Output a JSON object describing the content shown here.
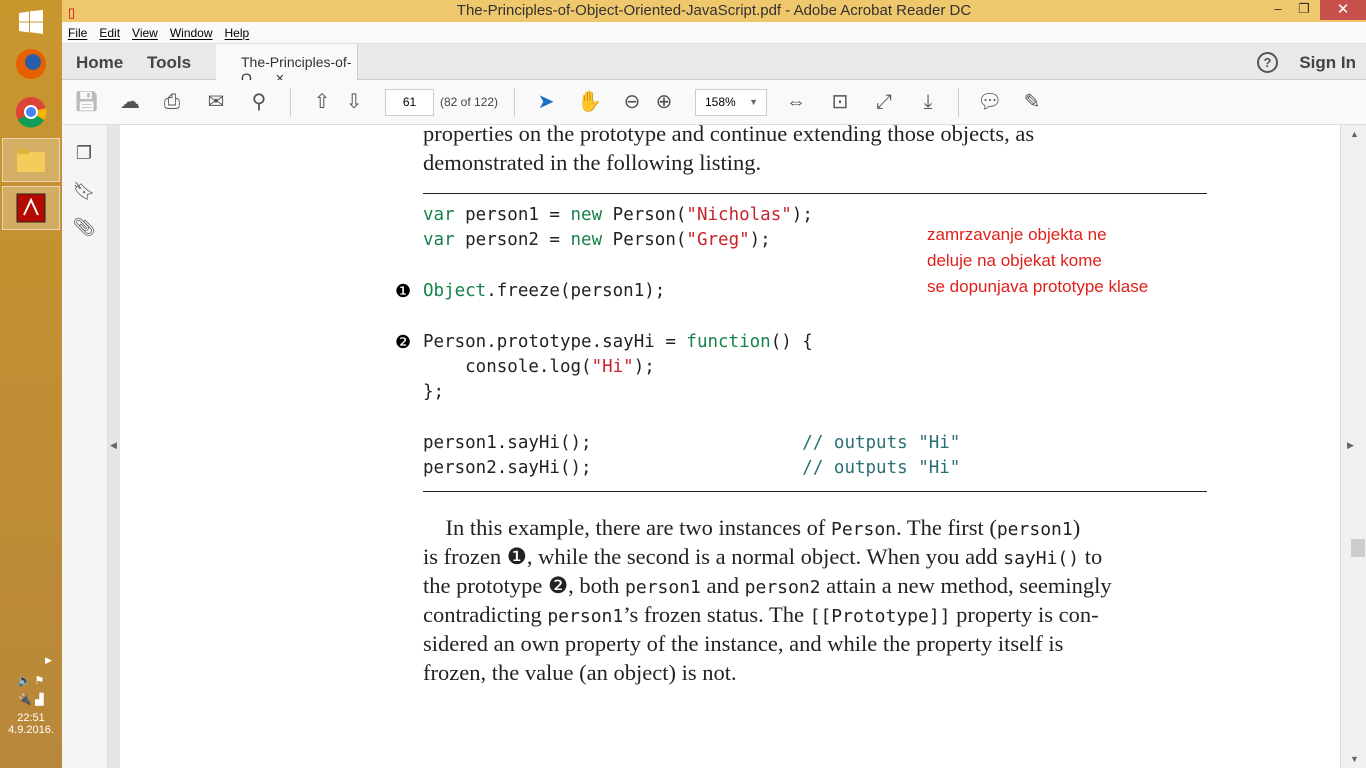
{
  "window": {
    "title": "The-Principles-of-Object-Oriented-JavaScript.pdf - Adobe Acrobat Reader DC",
    "minimize": "‒",
    "restore": "❐",
    "close": "✕"
  },
  "menu": [
    "File",
    "Edit",
    "View",
    "Window",
    "Help"
  ],
  "tabs": {
    "home": "Home",
    "tools": "Tools",
    "document": "The-Principles-of-O...",
    "close": "×",
    "help": "?",
    "sign_in": "Sign In"
  },
  "toolbar": {
    "page_number": "61",
    "page_count": "(82 of 122)",
    "zoom": "158%"
  },
  "tray": {
    "time": "22:51",
    "date": "4.9.2016."
  },
  "page": {
    "intro": [
      "properties on the prototype and continue extending those objects, as",
      "demonstrated in the following listing."
    ],
    "code": [
      [
        {
          "t": "var",
          "c": "kw"
        },
        {
          "t": " person1 = "
        },
        {
          "t": "new",
          "c": "kw"
        },
        {
          "t": " Person("
        },
        {
          "t": "\"Nicholas\"",
          "c": "str"
        },
        {
          "t": ");"
        }
      ],
      [
        {
          "t": "var",
          "c": "kw"
        },
        {
          "t": " person2 = "
        },
        {
          "t": "new",
          "c": "kw"
        },
        {
          "t": " Person("
        },
        {
          "t": "\"Greg\"",
          "c": "str"
        },
        {
          "t": ");"
        }
      ],
      [],
      [
        {
          "t": "Object",
          "c": "kw"
        },
        {
          "t": ".freeze(person1);"
        }
      ],
      [],
      [
        {
          "t": "Person.prototype.sayHi = "
        },
        {
          "t": "function",
          "c": "kw"
        },
        {
          "t": "() {"
        }
      ],
      [
        {
          "t": "    console.log("
        },
        {
          "t": "\"Hi\"",
          "c": "str"
        },
        {
          "t": ");"
        }
      ],
      [
        {
          "t": "};"
        }
      ],
      [],
      [
        {
          "t": "person1.sayHi();                    "
        },
        {
          "t": "// outputs \"Hi\"",
          "c": "cm"
        }
      ],
      [
        {
          "t": "person2.sayHi();                    "
        },
        {
          "t": "// outputs \"Hi\"",
          "c": "cm"
        }
      ]
    ],
    "markers": [
      "❶",
      "❷"
    ],
    "note": [
      "zamrzavanje objekta ne",
      "deluje na objekat kome",
      "se dopunjava prototype klase"
    ],
    "paragraph": [
      [
        {
          "t": "    In this example, there are two instances of "
        },
        {
          "t": "Person",
          "m": 1
        },
        {
          "t": ". The first ("
        },
        {
          "t": "person1",
          "m": 1
        },
        {
          "t": ")"
        }
      ],
      [
        {
          "t": "is frozen ❶, while the second is a normal object. When you add "
        },
        {
          "t": "sayHi()",
          "m": 1
        },
        {
          "t": " to"
        }
      ],
      [
        {
          "t": "the prototype ❷, both "
        },
        {
          "t": "person1",
          "m": 1
        },
        {
          "t": " and "
        },
        {
          "t": "person2",
          "m": 1
        },
        {
          "t": " attain a new method, seemingly"
        }
      ],
      [
        {
          "t": "contradicting "
        },
        {
          "t": "person1",
          "m": 1
        },
        {
          "t": "’s frozen status. The "
        },
        {
          "t": "[[Prototype]]",
          "m": 1
        },
        {
          "t": " property is con-"
        }
      ],
      [
        {
          "t": "sidered an own property of the instance, and while the property itself is"
        }
      ],
      [
        {
          "t": "frozen, the value (an object) is not."
        }
      ]
    ]
  },
  "colors": {
    "kw": "#16834a",
    "str": "#c8232c",
    "cm": "#2a6f73",
    "note": "#e0201c"
  }
}
